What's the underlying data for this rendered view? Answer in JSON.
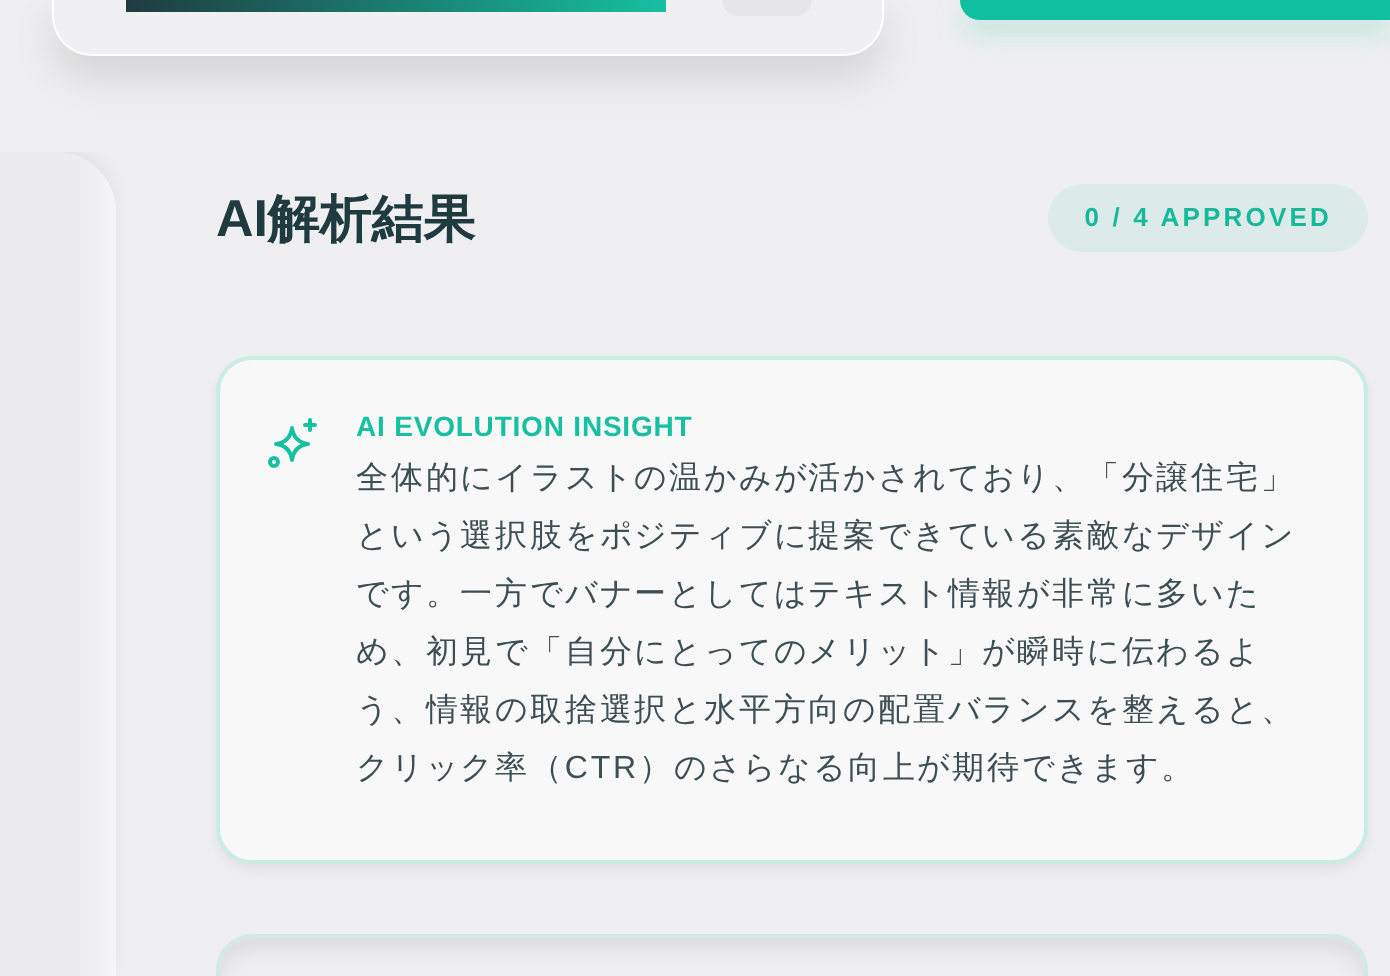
{
  "top_card": {
    "progress": {
      "level": 1
    }
  },
  "section": {
    "title": "AI解析結果",
    "badge": "0 / 4 APPROVED"
  },
  "insight": {
    "label": "AI EVOLUTION INSIGHT",
    "text": "全体的にイラストの温かみが活かされており、「分譲住宅」という選択肢をポジティブに提案できている素敵なデザインです。一方でバナーとしてはテキスト情報が非常に多いため、初見で「自分にとってのメリット」が瞬時に伝わるよう、情報の取捨選択と水平方向の配置バランスを整えると、クリック率（CTR）のさらなる向上が期待できます。"
  }
}
